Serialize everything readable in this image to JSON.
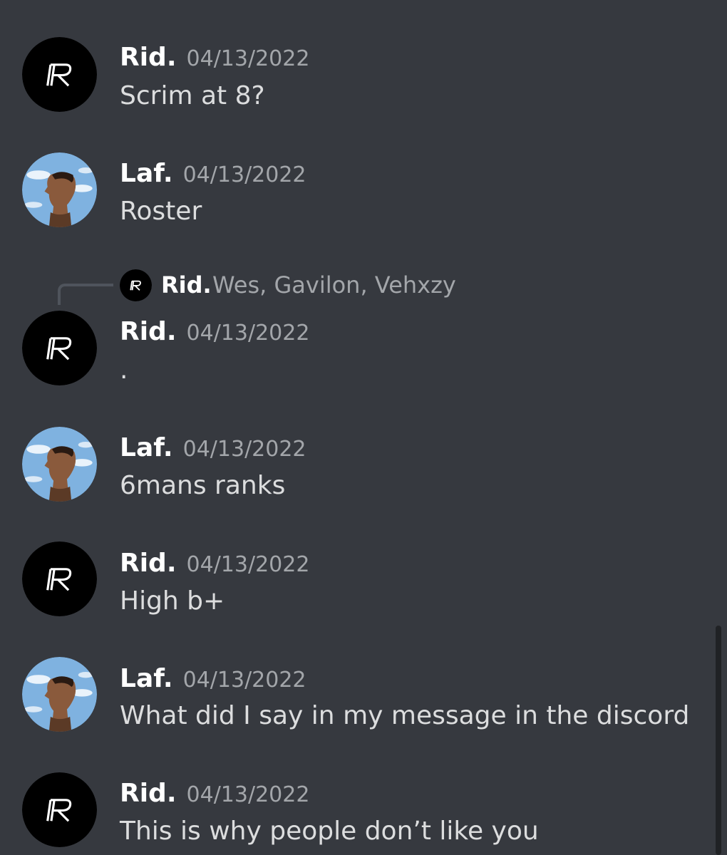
{
  "users": {
    "rid": {
      "name": "Rid.",
      "avatar_icon": "rid-logo-avatar",
      "avatar_bg": "#000000"
    },
    "laf": {
      "name": "Laf.",
      "avatar_icon": "profile-photo-sky-avatar",
      "avatar_bg": "#6fa8dc"
    }
  },
  "messages": [
    {
      "author": "Rid.",
      "timestamp": "04/13/2022",
      "text": "Scrim at 8?"
    },
    {
      "author": "Laf.",
      "timestamp": "04/13/2022",
      "text": "Roster"
    },
    {
      "author": "Rid.",
      "timestamp": "04/13/2022",
      "text": ".",
      "reply_to": {
        "author": "Rid.",
        "text": "Wes, Gavilon, Vehxzy"
      }
    },
    {
      "author": "Laf.",
      "timestamp": "04/13/2022",
      "text": "6mans ranks"
    },
    {
      "author": "Rid.",
      "timestamp": "04/13/2022",
      "text": "High b+"
    },
    {
      "author": "Laf.",
      "timestamp": "04/13/2022",
      "text": "What did I say in my message in the discord"
    },
    {
      "author": "Rid.",
      "timestamp": "04/13/2022",
      "text": "This is why people don’t like you"
    }
  ],
  "theme": {
    "background": "#36393f",
    "username_color": "#ffffff",
    "timestamp_color": "#a3a6aa",
    "text_color": "#dcddde"
  }
}
